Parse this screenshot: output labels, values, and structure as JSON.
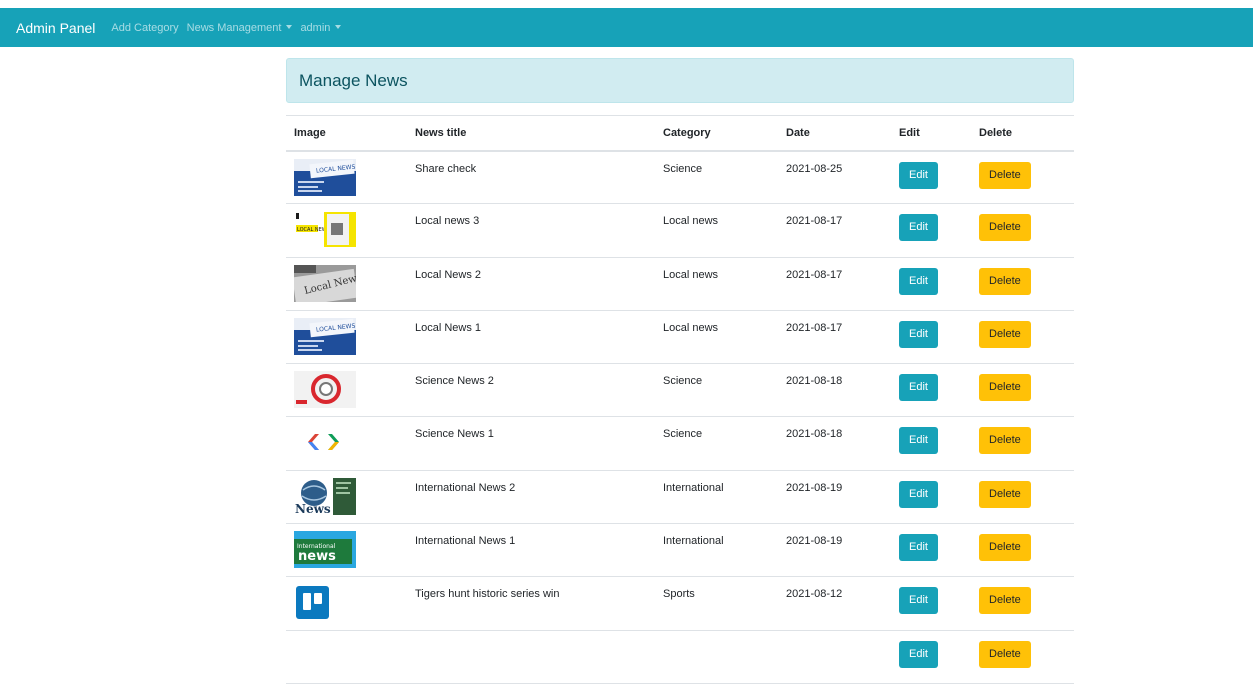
{
  "navbar": {
    "brand": "Admin Panel",
    "add_category": "Add Category",
    "news_management": "News Management",
    "user": "admin"
  },
  "header": {
    "title": "Manage News"
  },
  "table": {
    "columns": [
      "Image",
      "News title",
      "Category",
      "Date",
      "Edit",
      "Delete"
    ],
    "edit_label": "Edit",
    "delete_label": "Delete",
    "rows": [
      {
        "thumb": "local-news-blue",
        "title": "Share check",
        "category": "Science",
        "date": "2021-08-25"
      },
      {
        "thumb": "local-news-yellow",
        "title": "Local news 3",
        "category": "Local news",
        "date": "2021-08-17"
      },
      {
        "thumb": "local-news-paper",
        "title": "Local News 2",
        "category": "Local news",
        "date": "2021-08-17"
      },
      {
        "thumb": "local-news-blue",
        "title": "Local News 1",
        "category": "Local news",
        "date": "2021-08-17"
      },
      {
        "thumb": "science-red",
        "title": "Science News 2",
        "category": "Science",
        "date": "2021-08-18"
      },
      {
        "thumb": "chevron-code",
        "title": "Science News 1",
        "category": "Science",
        "date": "2021-08-18"
      },
      {
        "thumb": "globe-news",
        "title": "International News 2",
        "category": "International",
        "date": "2021-08-19"
      },
      {
        "thumb": "international-news-green",
        "title": "International News 1",
        "category": "International",
        "date": "2021-08-19"
      },
      {
        "thumb": "trello-blue",
        "title": "Tigers hunt historic series win",
        "category": "Sports",
        "date": "2021-08-12"
      }
    ]
  }
}
